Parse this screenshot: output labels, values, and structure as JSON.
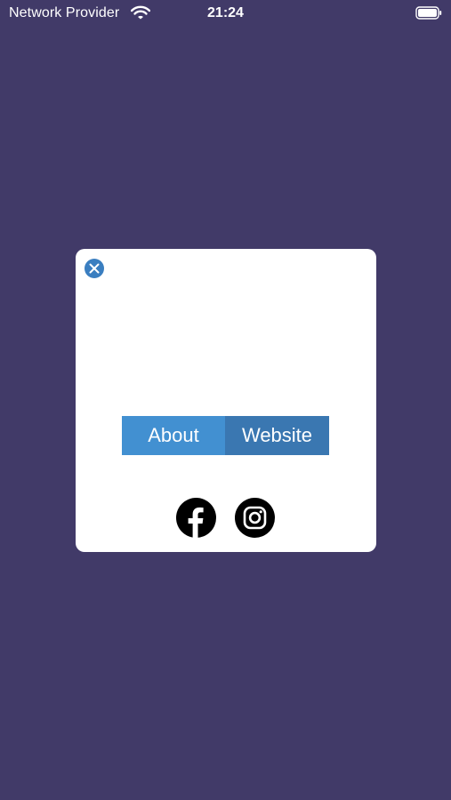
{
  "status_bar": {
    "carrier": "Network Provider",
    "time": "21:24",
    "wifi_icon": "wifi-icon",
    "battery_icon": "battery-icon"
  },
  "modal": {
    "close_icon": "close-icon",
    "tabs": [
      {
        "label": "About"
      },
      {
        "label": "Website"
      }
    ],
    "social": [
      {
        "icon": "facebook-icon"
      },
      {
        "icon": "instagram-icon"
      }
    ]
  },
  "colors": {
    "background": "#413a68",
    "card": "#ffffff",
    "tab_about": "#4290d1",
    "tab_website": "#3a77b1",
    "close_button": "#3a7ec0"
  }
}
